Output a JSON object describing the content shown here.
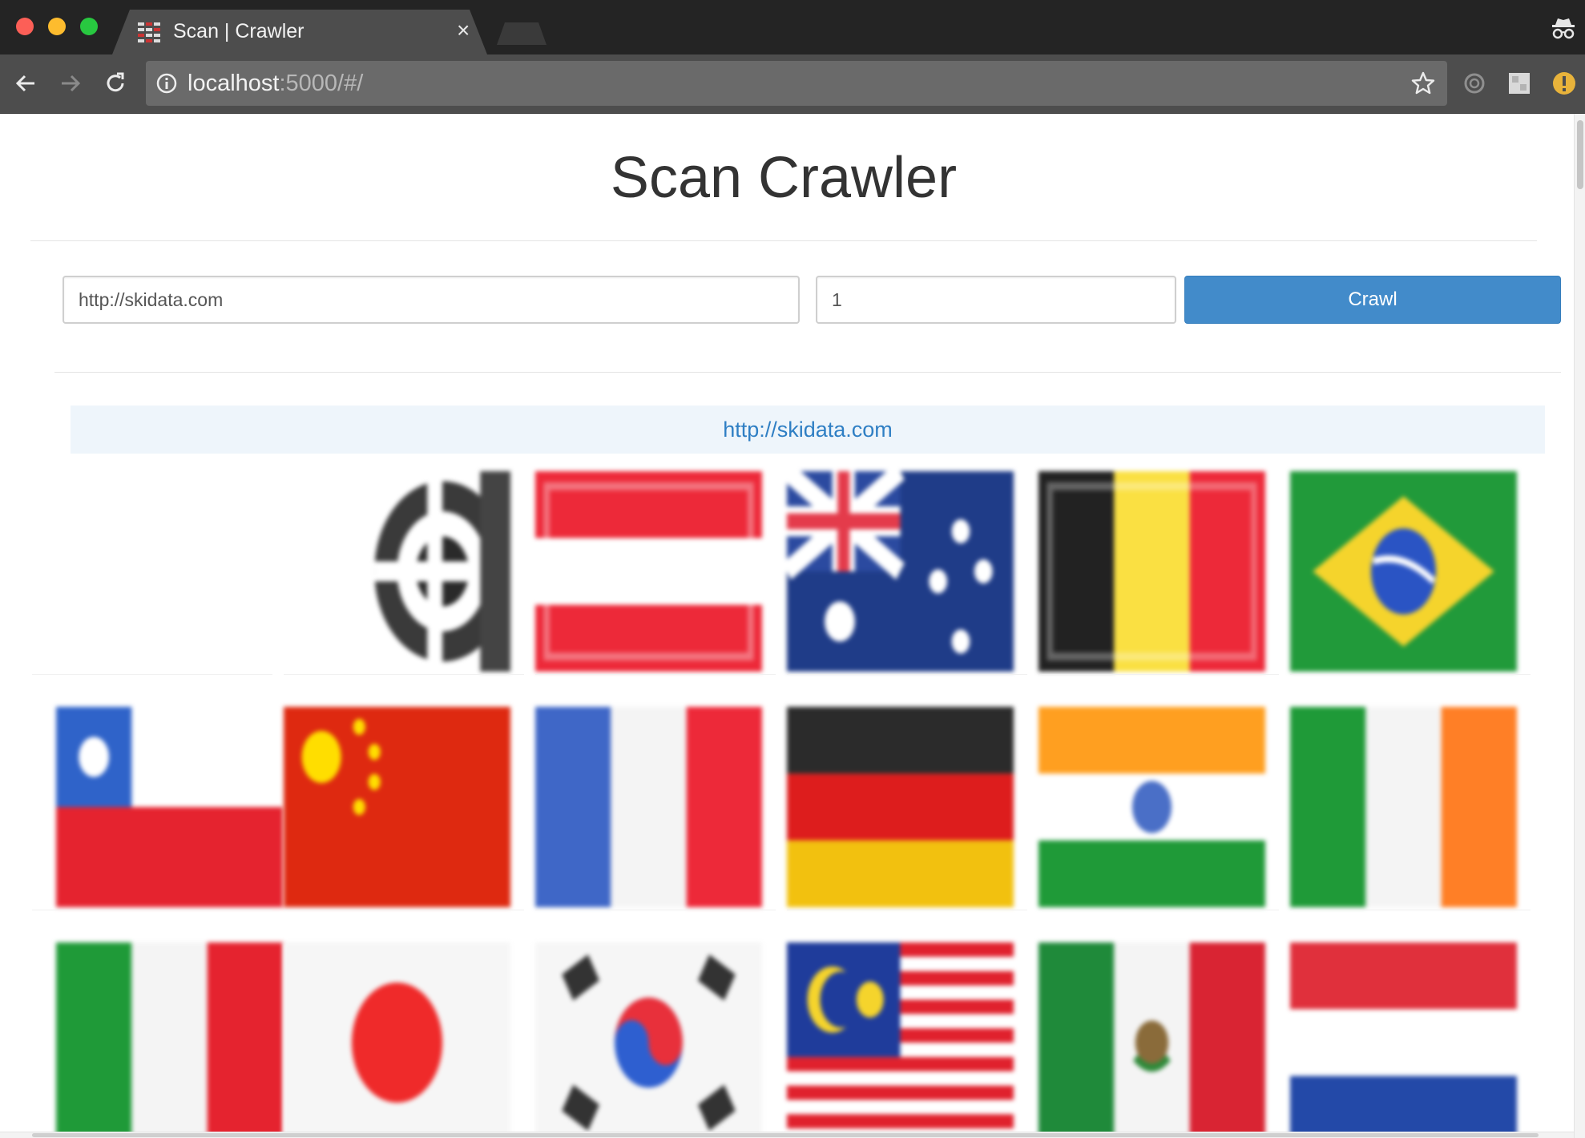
{
  "browser": {
    "tab_title": "Scan | Crawler",
    "tab_close": "×",
    "url_host": "localhost",
    "url_rest": ":5000/#/",
    "icons": [
      "favicon-icon",
      "close-icon",
      "incognito-icon",
      "back-icon",
      "forward-icon",
      "reload-icon",
      "info-icon",
      "bookmark-star-icon",
      "extension-icon",
      "extension-icon",
      "warning-icon"
    ]
  },
  "page": {
    "title": "Scan Crawler",
    "form": {
      "url_value": "http://skidata.com",
      "depth_value": "1",
      "crawl_label": "Crawl"
    },
    "result": {
      "url": "http://skidata.com",
      "images": [
        "blank",
        "logo-pattern",
        "austria",
        "australia",
        "belgium",
        "brazil",
        "chile",
        "china",
        "france",
        "germany",
        "india",
        "ireland",
        "italy",
        "japan",
        "south-korea",
        "malaysia",
        "mexico",
        "netherlands"
      ]
    }
  },
  "colors": {
    "primary_button": "#428bca",
    "link": "#2f7fc4",
    "result_header_bg": "#eef5fb"
  }
}
